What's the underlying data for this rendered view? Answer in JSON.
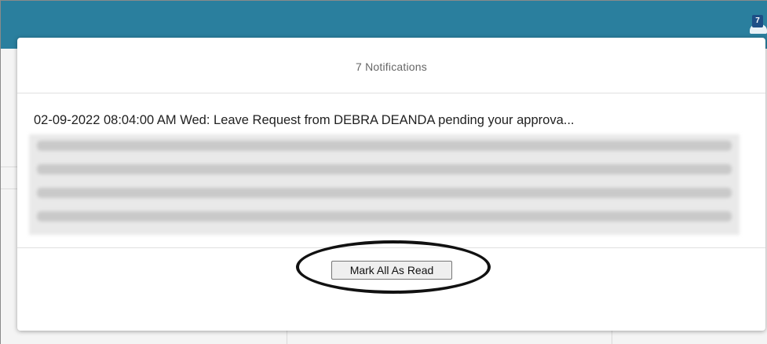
{
  "header": {
    "notification_badge": "7",
    "bell_icon": "bell-icon"
  },
  "modal": {
    "title": "7 Notifications",
    "notifications": [
      {
        "text": "02-09-2022 08:04:00 AM Wed: Leave Request from DEBRA DEANDA pending your approva..."
      }
    ],
    "mark_all_button_label": "Mark All As Read"
  },
  "colors": {
    "topbar": "#2a7f9e",
    "badge": "#1d4f86",
    "annotation": "#111111"
  }
}
